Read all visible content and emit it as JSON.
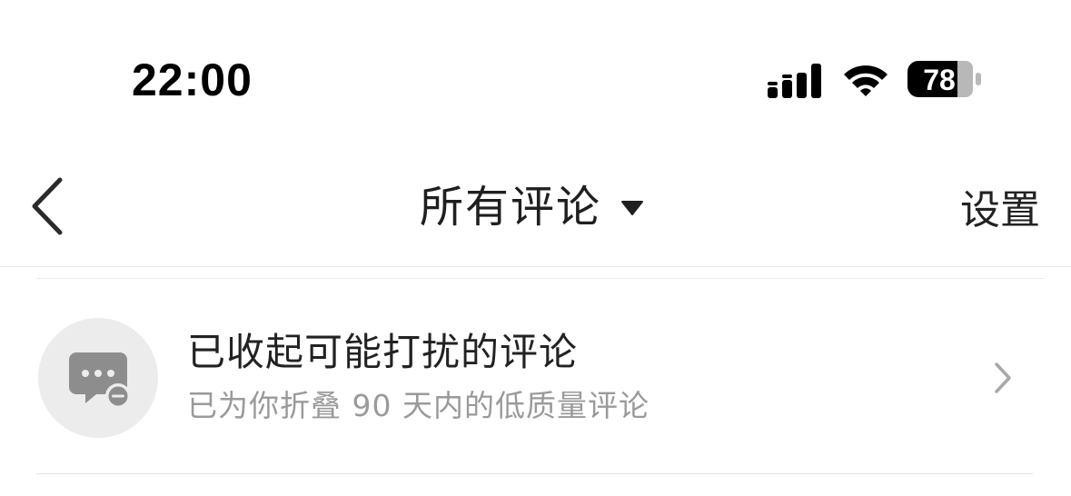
{
  "status_bar": {
    "time": "22:00",
    "battery_level": "78",
    "icons": [
      "signal-icon",
      "wifi-icon",
      "battery-icon"
    ]
  },
  "nav": {
    "back_icon": "chevron-left-icon",
    "title": "所有评论",
    "title_dropdown_icon": "caret-down-icon",
    "settings_label": "设置"
  },
  "folded_comments": {
    "icon": "comment-collapsed-icon",
    "title": "已收起可能打扰的评论",
    "subtitle": "已为你折叠 90 天内的低质量评论",
    "chevron_icon": "chevron-right-icon"
  },
  "colors": {
    "background": "#ffffff",
    "text_primary": "#222222",
    "text_secondary": "#9a9a9a",
    "icon_bg": "#ececec",
    "icon_fg": "#8d8d8d"
  }
}
